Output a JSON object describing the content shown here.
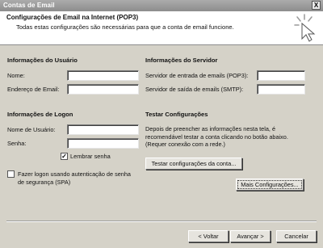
{
  "window": {
    "title": "Contas de Email",
    "close_glyph": "X"
  },
  "header": {
    "title": "Configurações de Email na Internet (POP3)",
    "subtitle": "Todas estas configurações são necessárias para que a conta de email funcione.",
    "icon": "cursor-sparkle-icon"
  },
  "user_info": {
    "heading": "Informações do Usuário",
    "name_label": "Nome:",
    "name_value": "",
    "email_label": "Endereço de Email:",
    "email_value": ""
  },
  "server_info": {
    "heading": "Informações do Servidor",
    "incoming_label": "Servidor de entrada de emails (POP3):",
    "incoming_value": "",
    "outgoing_label": "Servidor de saída de emails (SMTP):",
    "outgoing_value": ""
  },
  "logon_info": {
    "heading": "Informações de Logon",
    "username_label": "Nome de Usuário:",
    "username_value": "",
    "password_label": "Senha:",
    "password_value": "",
    "remember_label": "Lembrar senha",
    "remember_checked": true,
    "spa_label": "Fazer logon usando autenticação de senha de segurança (SPA)",
    "spa_checked": false
  },
  "test_settings": {
    "heading": "Testar Configurações",
    "description": "Depois de preencher as informações nesta tela, é recomendável testar a conta clicando no botão abaixo. (Requer conexão com a rede.)",
    "test_button": "Testar configurações da conta..."
  },
  "more_settings_button": "Mais Configurações...",
  "footer": {
    "back_button": "< Voltar",
    "next_button": "Avançar >",
    "cancel_button": "Cancelar"
  }
}
